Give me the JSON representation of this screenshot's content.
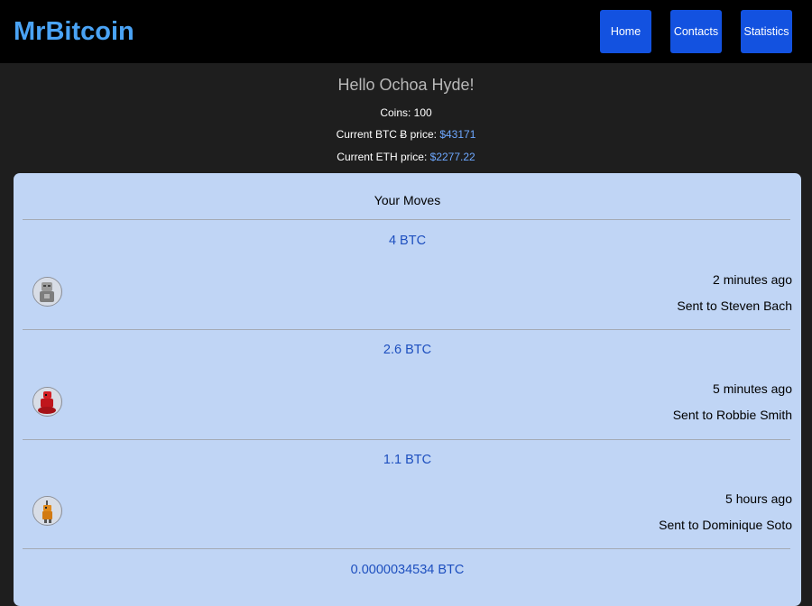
{
  "app": {
    "title": "MrBitcoin"
  },
  "nav": {
    "home": "Home",
    "contacts": "Contacts",
    "statistics": "Statistics"
  },
  "user": {
    "greeting": "Hello Ochoa Hyde!",
    "coins_text": "Coins: 100",
    "btc_label": "Current BTC Ƀ price:",
    "btc_price": "$43171",
    "eth_label": "Current ETH price:",
    "eth_price": "$2277.22"
  },
  "moves": {
    "title": "Your Moves",
    "items": [
      {
        "amount": "4 BTC",
        "time": "2 minutes ago",
        "to": "Sent to Steven Bach",
        "avatar_icon": "gray-robot-icon"
      },
      {
        "amount": "2.6 BTC",
        "time": "5 minutes ago",
        "to": "Sent to Robbie Smith",
        "avatar_icon": "red-robot-icon"
      },
      {
        "amount": "1.1 BTC",
        "time": "5 hours ago",
        "to": "Sent to Dominique Soto",
        "avatar_icon": "orange-robot-icon"
      },
      {
        "amount": "0.0000034534 BTC"
      }
    ]
  },
  "colors": {
    "logo": "#4aa3f5",
    "nav_button": "#1352e0",
    "panel": "#c0d5f5",
    "amount": "#1d4fbf",
    "price": "#6ea8ff"
  }
}
